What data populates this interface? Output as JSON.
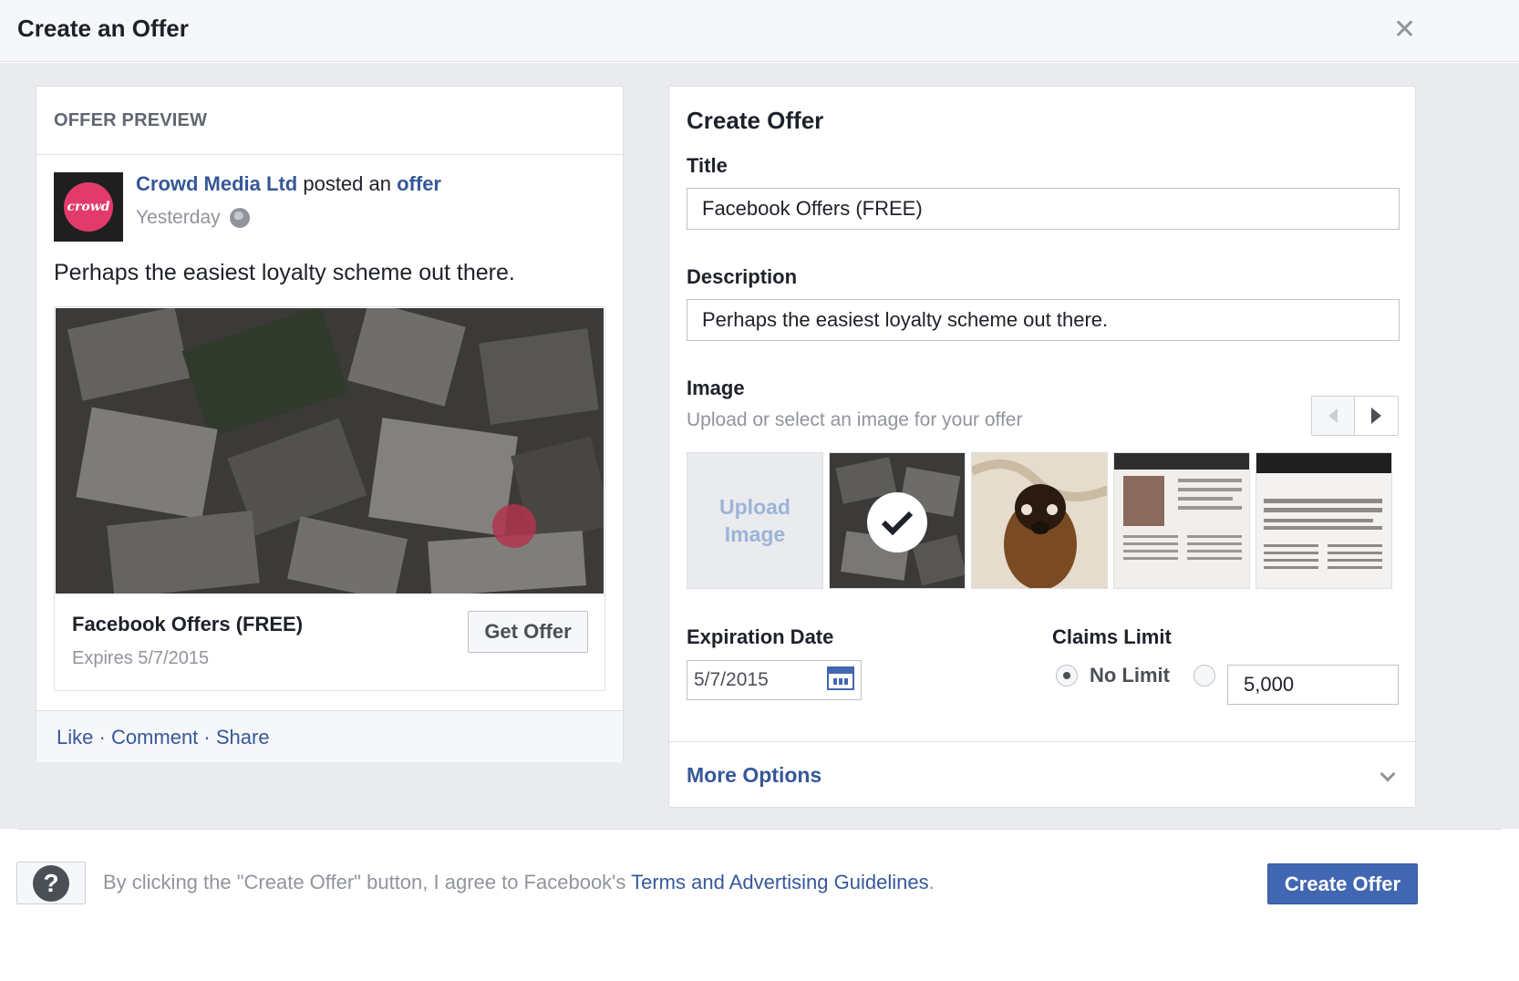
{
  "header": {
    "title": "Create an Offer",
    "close_icon": "close-icon"
  },
  "preview": {
    "heading": "OFFER PREVIEW",
    "page_name": "Crowd Media Ltd",
    "posted_text": "posted an",
    "offer_link": "offer",
    "time": "Yesterday",
    "avatar_text": "crowd",
    "post_text": "Perhaps the easiest loyalty scheme out there.",
    "offer_title": "Facebook Offers (FREE)",
    "offer_expires": "Expires 5/7/2015",
    "get_offer_label": "Get Offer",
    "actions": {
      "like": "Like",
      "comment": "Comment",
      "share": "Share",
      "separator": "·"
    }
  },
  "form": {
    "heading": "Create Offer",
    "title_label": "Title",
    "title_value": "Facebook Offers (FREE)",
    "description_label": "Description",
    "description_value": "Perhaps the easiest loyalty scheme out there.",
    "image_label": "Image",
    "image_sub": "Upload or select an image for your offer",
    "upload_label": "Upload Image",
    "expiration_label": "Expiration Date",
    "expiration_value": "5/7/2015",
    "claims_label": "Claims Limit",
    "no_limit_label": "No Limit",
    "no_limit_selected": true,
    "limit_value": "5,000",
    "more_options": "More Options"
  },
  "footer": {
    "terms_prefix": "By clicking the \"Create Offer\" button, I agree to Facebook's",
    "terms_link": "Terms and Advertising Guidelines",
    "terms_suffix": ".",
    "create_button": "Create Offer",
    "help_glyph": "?"
  },
  "colors": {
    "link": "#365899",
    "primary_button": "#4267b2",
    "avatar_brand": "#e23a6b"
  }
}
